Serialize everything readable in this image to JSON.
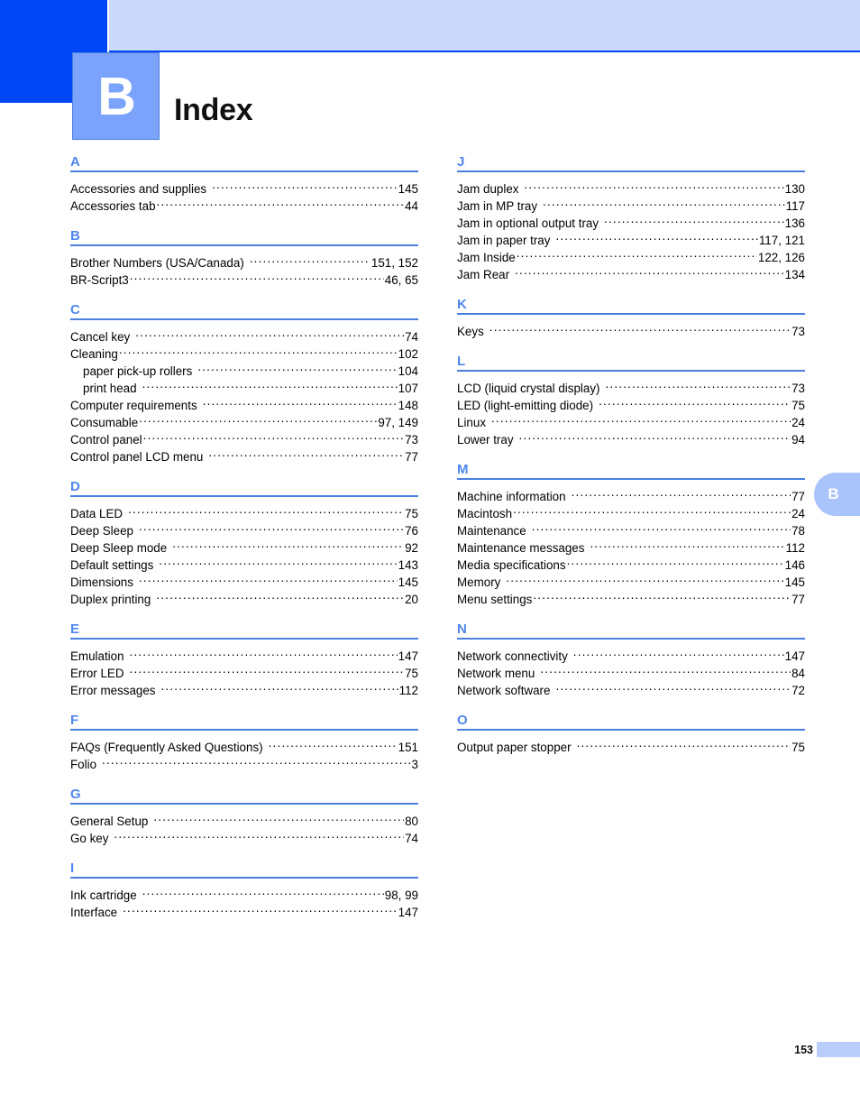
{
  "header": {
    "chapter_letter": "B",
    "title": "Index"
  },
  "thumb_tab": {
    "letter": "B"
  },
  "footer": {
    "page_number": "153"
  },
  "colors": {
    "header_dark_blue": "#0047f5",
    "header_light_blue": "#cbd9fa",
    "badge_blue": "#7ba3fb",
    "section_letter_blue": "#4f86ef",
    "rule_blue": "#4a7fe0",
    "tab_blue": "#a9c3fb"
  },
  "columns": {
    "left": [
      {
        "letter": "A",
        "entries": [
          {
            "label": "Accessories and supplies",
            "page": "145",
            "sub": false,
            "gap": true
          },
          {
            "label": "Accessories tab",
            "page": "44",
            "sub": false,
            "gap": false
          }
        ]
      },
      {
        "letter": "B",
        "entries": [
          {
            "label": "Brother Numbers (USA/Canada)",
            "page": "151, 152",
            "sub": false,
            "gap": true
          },
          {
            "label": "BR-Script3",
            "page": "46, 65",
            "sub": false,
            "gap": false
          }
        ]
      },
      {
        "letter": "C",
        "entries": [
          {
            "label": "Cancel key",
            "page": "74",
            "sub": false,
            "gap": true
          },
          {
            "label": "Cleaning",
            "page": "102",
            "sub": false,
            "gap": false
          },
          {
            "label": "paper pick-up rollers",
            "page": "104",
            "sub": true,
            "gap": true
          },
          {
            "label": "print head",
            "page": "107",
            "sub": true,
            "gap": true
          },
          {
            "label": "Computer requirements",
            "page": "148",
            "sub": false,
            "gap": true
          },
          {
            "label": "Consumable",
            "page": "97, 149",
            "sub": false,
            "gap": false
          },
          {
            "label": "Control panel",
            "page": "73",
            "sub": false,
            "gap": false
          },
          {
            "label": "Control panel LCD menu",
            "page": "77",
            "sub": false,
            "gap": true
          }
        ]
      },
      {
        "letter": "D",
        "entries": [
          {
            "label": "Data LED",
            "page": "75",
            "sub": false,
            "gap": true
          },
          {
            "label": "Deep Sleep",
            "page": "76",
            "sub": false,
            "gap": true
          },
          {
            "label": "Deep Sleep mode",
            "page": "92",
            "sub": false,
            "gap": true
          },
          {
            "label": "Default settings",
            "page": "143",
            "sub": false,
            "gap": true
          },
          {
            "label": "Dimensions",
            "page": "145",
            "sub": false,
            "gap": true
          },
          {
            "label": "Duplex printing",
            "page": "20",
            "sub": false,
            "gap": true
          }
        ]
      },
      {
        "letter": "E",
        "entries": [
          {
            "label": "Emulation",
            "page": "147",
            "sub": false,
            "gap": true
          },
          {
            "label": "Error LED",
            "page": "75",
            "sub": false,
            "gap": true
          },
          {
            "label": "Error messages",
            "page": "112",
            "sub": false,
            "gap": true
          }
        ]
      },
      {
        "letter": "F",
        "entries": [
          {
            "label": "FAQs (Frequently Asked Questions)",
            "page": "151",
            "sub": false,
            "gap": true
          },
          {
            "label": "Folio",
            "page": "3",
            "sub": false,
            "gap": true
          }
        ]
      },
      {
        "letter": "G",
        "entries": [
          {
            "label": "General Setup",
            "page": "80",
            "sub": false,
            "gap": true
          },
          {
            "label": "Go key",
            "page": "74",
            "sub": false,
            "gap": true
          }
        ]
      },
      {
        "letter": "I",
        "entries": [
          {
            "label": "Ink cartridge",
            "page": "98, 99",
            "sub": false,
            "gap": true
          },
          {
            "label": "Interface",
            "page": "147",
            "sub": false,
            "gap": true
          }
        ]
      }
    ],
    "right": [
      {
        "letter": "J",
        "entries": [
          {
            "label": "Jam duplex",
            "page": "130",
            "sub": false,
            "gap": true
          },
          {
            "label": "Jam in MP tray",
            "page": "117",
            "sub": false,
            "gap": true
          },
          {
            "label": "Jam in optional output tray",
            "page": "136",
            "sub": false,
            "gap": true
          },
          {
            "label": "Jam in paper tray",
            "page": "117, 121",
            "sub": false,
            "gap": true
          },
          {
            "label": "Jam Inside",
            "page": "122, 126",
            "sub": false,
            "gap": false
          },
          {
            "label": "Jam Rear",
            "page": "134",
            "sub": false,
            "gap": true
          }
        ]
      },
      {
        "letter": "K",
        "entries": [
          {
            "label": "Keys",
            "page": "73",
            "sub": false,
            "gap": true
          }
        ]
      },
      {
        "letter": "L",
        "entries": [
          {
            "label": "LCD (liquid crystal display)",
            "page": "73",
            "sub": false,
            "gap": true
          },
          {
            "label": "LED (light-emitting diode)",
            "page": "75",
            "sub": false,
            "gap": true
          },
          {
            "label": "Linux",
            "page": "24",
            "sub": false,
            "gap": true
          },
          {
            "label": "Lower tray",
            "page": "94",
            "sub": false,
            "gap": true
          }
        ]
      },
      {
        "letter": "M",
        "entries": [
          {
            "label": "Machine information",
            "page": "77",
            "sub": false,
            "gap": true
          },
          {
            "label": "Macintosh",
            "page": "24",
            "sub": false,
            "gap": false
          },
          {
            "label": "Maintenance",
            "page": "78",
            "sub": false,
            "gap": true
          },
          {
            "label": "Maintenance messages",
            "page": "112",
            "sub": false,
            "gap": true
          },
          {
            "label": "Media specifications",
            "page": "146",
            "sub": false,
            "gap": false
          },
          {
            "label": "Memory",
            "page": "145",
            "sub": false,
            "gap": true
          },
          {
            "label": "Menu settings",
            "page": "77",
            "sub": false,
            "gap": false
          }
        ]
      },
      {
        "letter": "N",
        "entries": [
          {
            "label": "Network connectivity",
            "page": "147",
            "sub": false,
            "gap": true
          },
          {
            "label": "Network menu",
            "page": "84",
            "sub": false,
            "gap": true
          },
          {
            "label": "Network software",
            "page": "72",
            "sub": false,
            "gap": true
          }
        ]
      },
      {
        "letter": "O",
        "entries": [
          {
            "label": "Output paper stopper",
            "page": "75",
            "sub": false,
            "gap": true
          }
        ]
      }
    ]
  }
}
